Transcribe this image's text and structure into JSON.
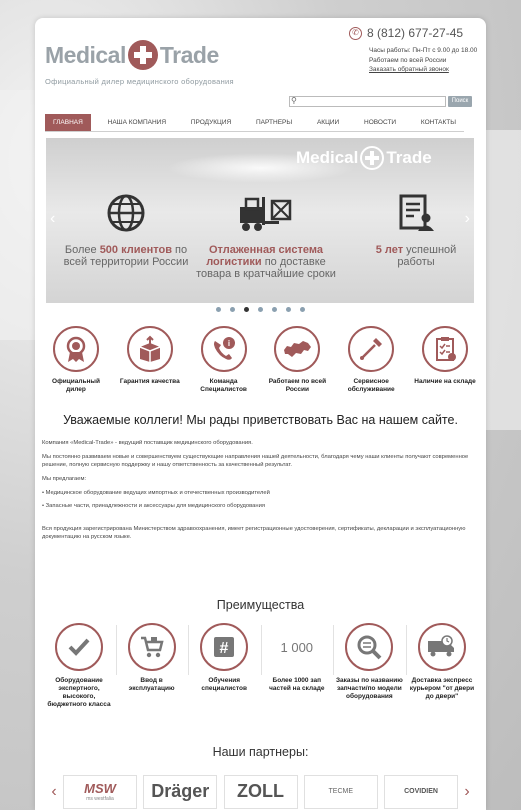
{
  "header": {
    "logo_left": "Medical",
    "logo_right": "Trade",
    "tagline": "Официальный дилер медицинского оборудования",
    "phone": "8 (812) 677-27-45",
    "hours_line1": "Часы работы: Пн-Пт с 9.00 до 18.00",
    "hours_line2": "Работаем по всей России",
    "callback": "Заказать обратный звонок",
    "search_placeholder": "",
    "search_button": "Поиск"
  },
  "nav": [
    "ГЛАВНАЯ",
    "НАША КОМПАНИЯ",
    "ПРОДУКЦИЯ",
    "ПАРТНЕРЫ",
    "АКЦИИ",
    "НОВОСТИ",
    "КОНТАКТЫ"
  ],
  "slider": {
    "logo_left": "Medical",
    "logo_right": "Trade",
    "features": [
      {
        "pre": "Более ",
        "bold": "500 клиентов",
        "post": " по всей территории России"
      },
      {
        "pre": "",
        "bold": "Отлаженная система логистики",
        "post": " по доставке товара в кратчайшие сроки"
      },
      {
        "pre": "",
        "bold": "5 лет",
        "post": " успешной работы"
      }
    ],
    "dots": 7,
    "active_dot": 2
  },
  "icons": [
    {
      "icon": "badge-icon",
      "label": "Официальный дилер"
    },
    {
      "icon": "box-icon",
      "label": "Гарантия качества"
    },
    {
      "icon": "support-icon",
      "label": "Команда Специалистов"
    },
    {
      "icon": "russia-map-icon",
      "label": "Работаем по всей России"
    },
    {
      "icon": "screwdriver-icon",
      "label": "Сервисное обслуживание"
    },
    {
      "icon": "checklist-icon",
      "label": "Наличие на складе"
    }
  ],
  "welcome": "Уважаемые коллеги! Мы рады приветствовать Вас на нашем сайте.",
  "body": {
    "p1": "Компания «Medical-Trade» - ведущий поставщик медицинского оборудования.",
    "p2": "Мы постоянно развиваем новые и совершенствуем существующие направления нашей деятельности, благодаря чему наши клиенты получают современное решение, полную сервисную поддержку и нашу ответственность за качественный результат.",
    "p3": "Мы предлагаем:",
    "b1": "• Медицинское оборудование ведущих импортных и отечественных производителей",
    "b2": "• Запасные части, принадлежности и аксессуары для медицинского оборудования",
    "p4": "Вся продукция зарегистрирована Министерством здравоохранения, имеет регистрационные удостоверения, сертификаты, декларации и эксплуатационную документацию на русском языке."
  },
  "advantages_title": "Преимущества",
  "advantages": [
    {
      "icon": "check-icon",
      "label": "Оборудование экспертного, высокого, бюджетного класса"
    },
    {
      "icon": "cart-icon",
      "label": "Ввод в эксплуатацию"
    },
    {
      "icon": "hash-icon",
      "label": "Обучения специалистов"
    },
    {
      "icon": "number-icon",
      "num": "1 000",
      "label": "Более 1000 зап частей на складе"
    },
    {
      "icon": "search-icon",
      "label": "Заказы по названию запчасти/по модели оборудования"
    },
    {
      "icon": "delivery-clock-icon",
      "label": "Доставка экспресс курьером \"от двери до двери\""
    }
  ],
  "partners_title": "Наши партнеры:",
  "partners": [
    {
      "name": "MSW",
      "sub": "ms westfalia"
    },
    {
      "name": "Dräger",
      "sub": ""
    },
    {
      "name": "ZOLL",
      "sub": ""
    },
    {
      "name": "TECME",
      "sub": ""
    },
    {
      "name": "COVIDIEN",
      "sub": ""
    }
  ],
  "colors": {
    "accent": "#a05a5a",
    "gray_text": "#9aa2a8",
    "nav_active_bg": "#a05a5a"
  }
}
